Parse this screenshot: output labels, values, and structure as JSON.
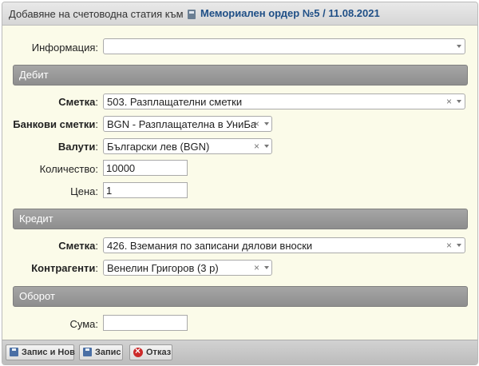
{
  "dialog": {
    "title": "Добавяне на счетоводна статия към",
    "order_link": "Мемориален ордер №5 / 11.08.2021"
  },
  "info": {
    "label": "Информация:",
    "value": ""
  },
  "debit": {
    "section_title": "Дебит",
    "account": {
      "label": "Сметка",
      "value": "503. Разплащателни сметки"
    },
    "bank_accounts": {
      "label": "Банкови сметки",
      "value": "BGN - Разплащателна в УниБа..."
    },
    "currencies": {
      "label": "Валути",
      "value": "Български лев (BGN)"
    },
    "quantity": {
      "label": "Количество:",
      "value": "10000"
    },
    "price": {
      "label": "Цена:",
      "value": "1"
    }
  },
  "credit": {
    "section_title": "Кредит",
    "account": {
      "label": "Сметка",
      "value": "426. Вземания по записани дялови вноски"
    },
    "counterparties": {
      "label": "Контрагенти",
      "value": "Венелин Григоров (3 р)"
    }
  },
  "turnover": {
    "section_title": "Оборот",
    "amount": {
      "label": "Сума:",
      "value": ""
    }
  },
  "footer": {
    "save_new": "Запис и Нов",
    "save": "Запис",
    "cancel": "Отказ"
  },
  "glyphs": {
    "clear": "×",
    "colon": ":"
  }
}
